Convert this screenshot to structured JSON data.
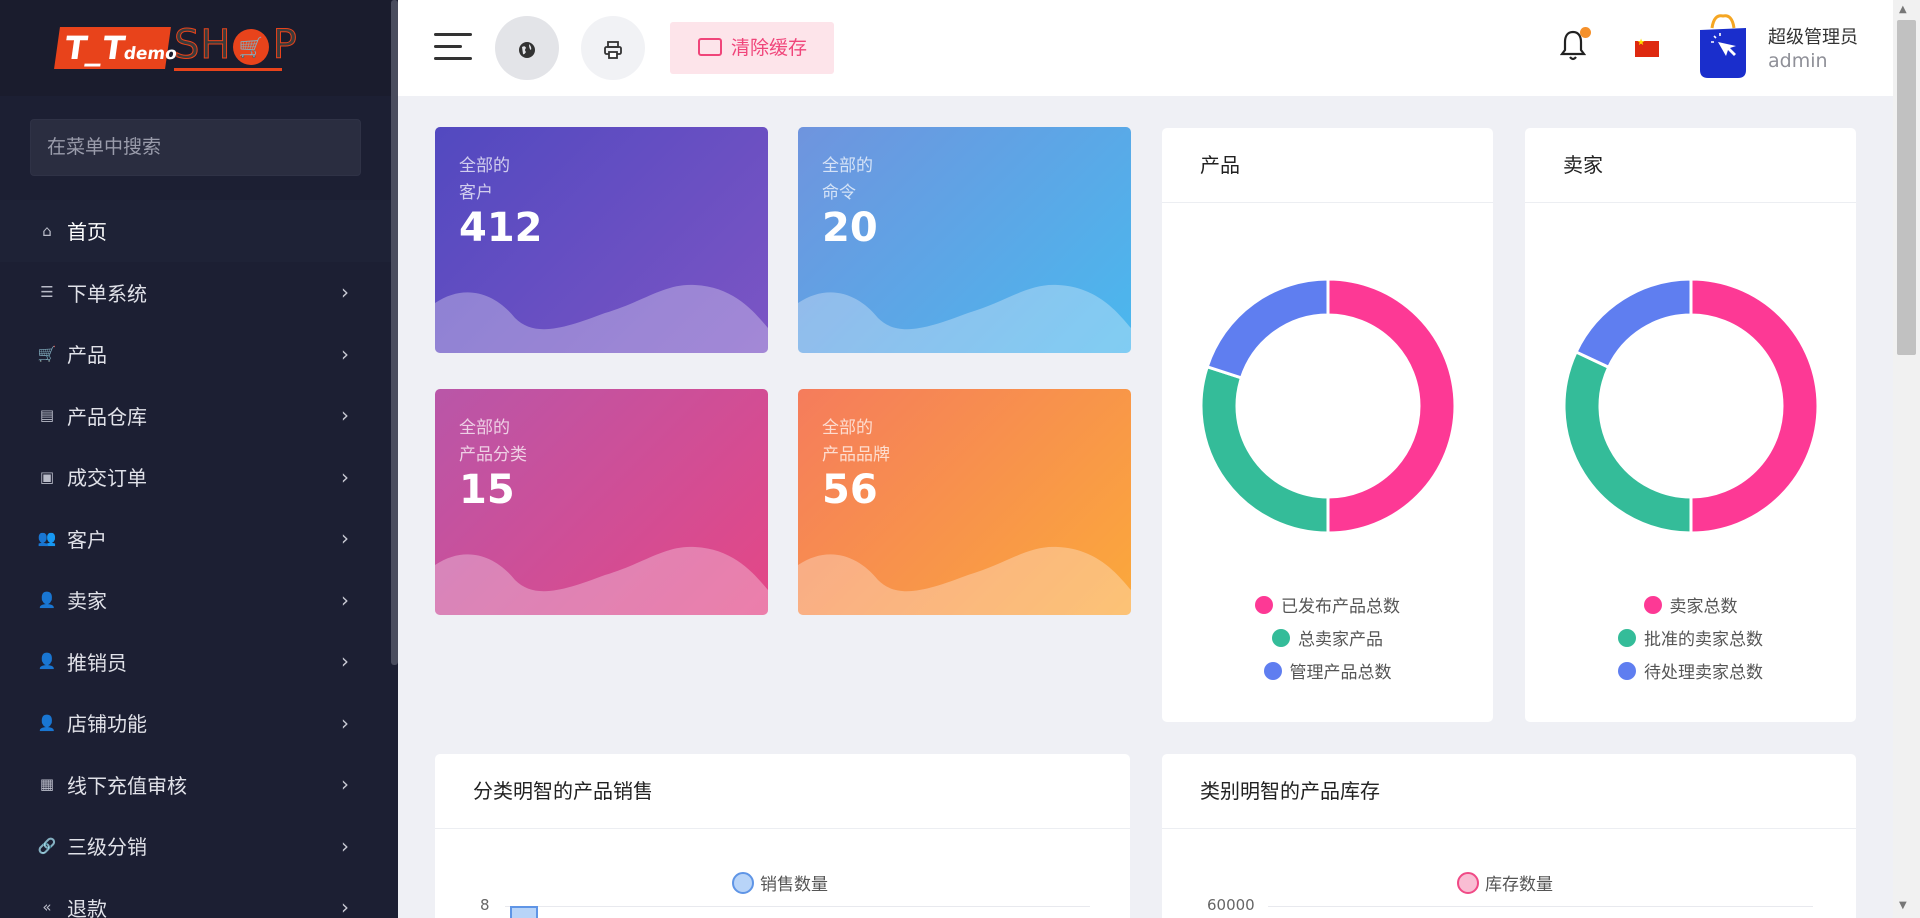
{
  "logo": {
    "part1": "T_T",
    "part1_small": "demo",
    "part2": "SH",
    "part2b": "P",
    "cart_icon": "cart-icon"
  },
  "sidebar": {
    "search_placeholder": "在菜单中搜索",
    "items": [
      {
        "label": "首页",
        "icon": "⌂",
        "icon_name": "home-icon",
        "active": true,
        "has_children": false
      },
      {
        "label": "下单系统",
        "icon": "☰",
        "icon_name": "list-icon",
        "has_children": true
      },
      {
        "label": "产品",
        "icon": "🛒",
        "icon_name": "cart-icon",
        "has_children": true
      },
      {
        "label": "产品仓库",
        "icon": "▤",
        "icon_name": "warehouse-icon",
        "has_children": true
      },
      {
        "label": "成交订单",
        "icon": "▣",
        "icon_name": "money-icon",
        "has_children": true
      },
      {
        "label": "客户",
        "icon": "👥",
        "icon_name": "users-icon",
        "has_children": true
      },
      {
        "label": "卖家",
        "icon": "👤",
        "icon_name": "user-icon",
        "has_children": true
      },
      {
        "label": "推销员",
        "icon": "👤",
        "icon_name": "user-icon",
        "has_children": true
      },
      {
        "label": "店铺功能",
        "icon": "👤",
        "icon_name": "user-icon",
        "has_children": true
      },
      {
        "label": "线下充值审核",
        "icon": "▦",
        "icon_name": "payment-icon",
        "has_children": true
      },
      {
        "label": "三级分销",
        "icon": "🔗",
        "icon_name": "link-icon",
        "has_children": true
      },
      {
        "label": "退款",
        "icon": "«",
        "icon_name": "refund-icon",
        "has_children": true
      }
    ]
  },
  "header": {
    "clear_cache_label": "清除缓存",
    "user_name": "超级管理员",
    "user_role": "admin"
  },
  "stats": [
    {
      "label1": "全部的",
      "label2": "客户",
      "value": "412"
    },
    {
      "label1": "全部的",
      "label2": "命令",
      "value": "20"
    },
    {
      "label1": "全部的",
      "label2": "产品分类",
      "value": "15"
    },
    {
      "label1": "全部的",
      "label2": "产品品牌",
      "value": "56"
    }
  ],
  "colors": {
    "pink": "#fd3995",
    "green": "#34bc99",
    "blue": "#5f7ef0"
  },
  "chart_data": [
    {
      "type": "pie",
      "title": "产品",
      "labels": [
        "已发布产品总数",
        "总卖家产品",
        "管理产品总数"
      ],
      "values": [
        50,
        30,
        20
      ],
      "colors": [
        "#fd3995",
        "#34bc99",
        "#5f7ef0"
      ]
    },
    {
      "type": "pie",
      "title": "卖家",
      "labels": [
        "卖家总数",
        "批准的卖家总数",
        "待处理卖家总数"
      ],
      "values": [
        50,
        32,
        18
      ],
      "colors": [
        "#fd3995",
        "#34bc99",
        "#5f7ef0"
      ]
    },
    {
      "type": "bar",
      "title": "分类明智的产品销售",
      "series": [
        {
          "name": "销售数量"
        }
      ],
      "y_tick_top": "8"
    },
    {
      "type": "bar",
      "title": "类别明智的产品库存",
      "series": [
        {
          "name": "库存数量"
        }
      ],
      "y_tick_top": "60000"
    }
  ]
}
